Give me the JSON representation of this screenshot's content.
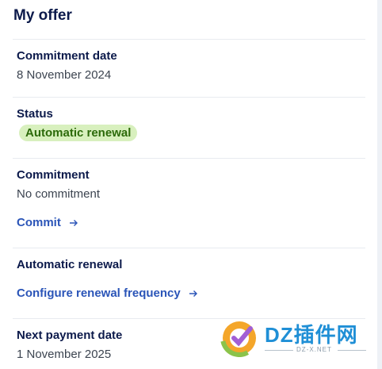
{
  "offer": {
    "title": "My offer",
    "commitment_date": {
      "label": "Commitment date",
      "value": "8 November 2024"
    },
    "status": {
      "label": "Status",
      "badge": "Automatic renewal",
      "badge_color": "#d8f0be"
    },
    "commitment": {
      "label": "Commitment",
      "value": "No commitment",
      "link": "Commit"
    },
    "automatic_renewal": {
      "label": "Automatic renewal",
      "link": "Configure renewal frequency"
    },
    "next_payment": {
      "label": "Next payment date",
      "value": "1 November 2025"
    }
  },
  "watermark": {
    "text": "DZ插件网",
    "sub": "DZ-X.NET"
  },
  "colors": {
    "heading": "#0c1a4b",
    "link": "#2b55b8",
    "text": "#3c4450"
  }
}
